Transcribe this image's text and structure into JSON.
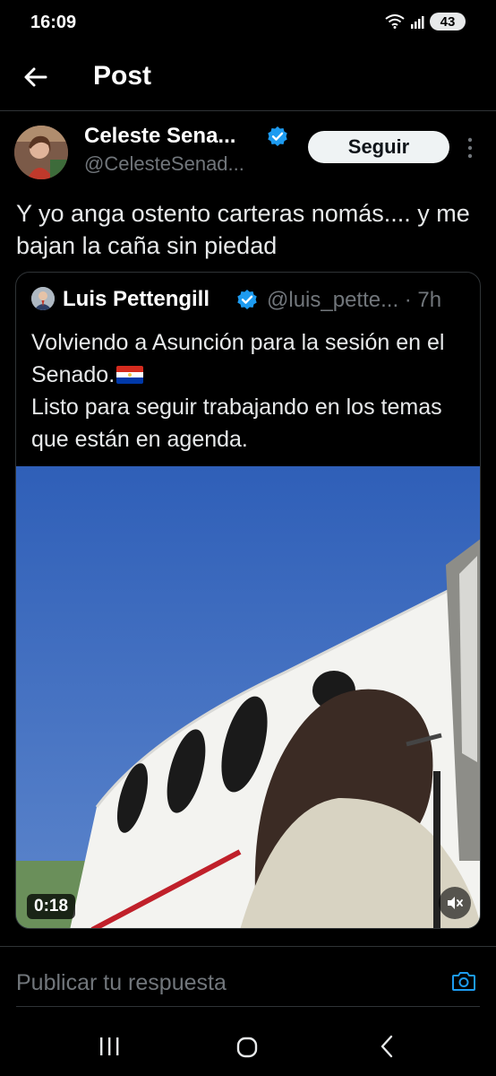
{
  "status_bar": {
    "time": "16:09",
    "battery": "43"
  },
  "header": {
    "title": "Post"
  },
  "author": {
    "name": "Celeste Sena...",
    "handle": "@CelesteSenad...",
    "follow_label": "Seguir"
  },
  "tweet": {
    "text": "Y yo anga ostento carteras nomás.... y me bajan la caña sin piedad"
  },
  "quote": {
    "name": "Luis Pettengill",
    "handle": "@luis_pette... · 7h",
    "line1": "Volviendo a Asunción para la sesión en el Senado.",
    "line2": "Listo para seguir trabajando en los temas que están en agenda.",
    "video_duration": "0:18"
  },
  "reply": {
    "placeholder": "Publicar tu respuesta"
  },
  "colors": {
    "background": "#000000",
    "accent": "#1d9bf0",
    "muted": "#71767b"
  },
  "icons": [
    "back-arrow-icon",
    "verified-badge-icon",
    "more-icon",
    "mute-icon",
    "camera-icon",
    "nav-recent-icon",
    "nav-home-icon",
    "nav-back-icon"
  ]
}
